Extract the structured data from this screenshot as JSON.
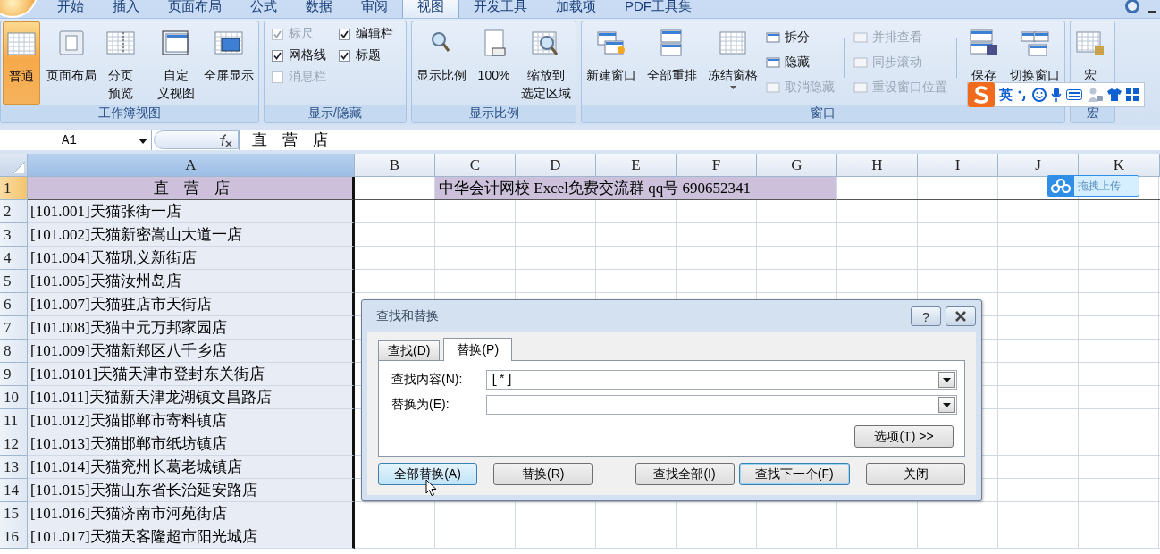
{
  "ribbon_tabs": [
    {
      "label": "开始",
      "selected": false
    },
    {
      "label": "插入",
      "selected": false
    },
    {
      "label": "页面布局",
      "selected": false
    },
    {
      "label": "公式",
      "selected": false
    },
    {
      "label": "数据",
      "selected": false
    },
    {
      "label": "审阅",
      "selected": false
    },
    {
      "label": "视图",
      "selected": true
    },
    {
      "label": "开发工具",
      "selected": false
    },
    {
      "label": "加载项",
      "selected": false
    },
    {
      "label": "PDF工具集",
      "selected": false
    }
  ],
  "ribbon_groups": [
    {
      "label": "工作簿视图",
      "items": [
        {
          "kind": "large",
          "label": "普通",
          "selected": true,
          "disabled": false,
          "wrap": false
        },
        {
          "kind": "large",
          "label": "页面布局",
          "selected": false,
          "disabled": false,
          "wrap": false
        },
        {
          "kind": "large",
          "label": "分页预览",
          "selected": false,
          "disabled": false,
          "wrap": true
        },
        {
          "kind": "separator"
        },
        {
          "kind": "large",
          "label": "自定义视图",
          "selected": false,
          "disabled": false,
          "wrap": true
        },
        {
          "kind": "large",
          "label": "全屏显示",
          "selected": false,
          "disabled": false,
          "wrap": false
        }
      ]
    },
    {
      "label": "显示/隐藏",
      "items": [
        {
          "kind": "check",
          "label": "标尺",
          "checked": true,
          "disabled": true
        },
        {
          "kind": "check",
          "label": "编辑栏",
          "checked": true,
          "disabled": false
        },
        {
          "kind": "check",
          "label": "网格线",
          "checked": true,
          "disabled": false
        },
        {
          "kind": "check",
          "label": "标题",
          "checked": true,
          "disabled": false
        },
        {
          "kind": "check",
          "label": "消息栏",
          "checked": false,
          "disabled": true
        }
      ]
    },
    {
      "label": "显示比例",
      "items": [
        {
          "kind": "large",
          "label": "显示比例",
          "selected": false,
          "disabled": false,
          "wrap": false
        },
        {
          "kind": "large",
          "label": "100%",
          "selected": false,
          "disabled": false,
          "wrap": false
        },
        {
          "kind": "large",
          "label": "缩放到选定区域",
          "selected": false,
          "disabled": false,
          "wrap": true
        }
      ]
    },
    {
      "label": "窗口",
      "items": [
        {
          "kind": "large",
          "label": "新建窗口",
          "selected": false,
          "disabled": false,
          "wrap": false
        },
        {
          "kind": "large",
          "label": "全部重排",
          "selected": false,
          "disabled": false,
          "wrap": false
        },
        {
          "kind": "large",
          "label": "冻结窗格",
          "selected": false,
          "disabled": false,
          "wrap": false,
          "dropdown": true
        },
        {
          "kind": "stack",
          "items": [
            {
              "label": "拆分",
              "disabled": false
            },
            {
              "label": "隐藏",
              "disabled": false
            },
            {
              "label": "取消隐藏",
              "disabled": true
            }
          ]
        },
        {
          "kind": "separator"
        },
        {
          "kind": "stack",
          "items": [
            {
              "label": "并排查看",
              "disabled": true
            },
            {
              "label": "同步滚动",
              "disabled": true
            },
            {
              "label": "重设窗口位置",
              "disabled": true
            }
          ]
        },
        {
          "kind": "separator"
        },
        {
          "kind": "large",
          "label": "保存",
          "selected": false,
          "disabled": false,
          "wrap": false
        },
        {
          "kind": "large",
          "label": "切换窗口",
          "selected": false,
          "disabled": false,
          "wrap": false
        }
      ]
    },
    {
      "label": "宏",
      "items": [
        {
          "kind": "large",
          "label": "宏",
          "selected": false,
          "disabled": false,
          "wrap": false
        }
      ]
    }
  ],
  "formula_bar": {
    "name_box": "A1",
    "formula": "直　营　店"
  },
  "columns": [
    {
      "label": "A",
      "selected": true
    },
    {
      "label": "B",
      "selected": false
    },
    {
      "label": "C",
      "selected": false
    },
    {
      "label": "D",
      "selected": false
    },
    {
      "label": "E",
      "selected": false
    },
    {
      "label": "F",
      "selected": false
    },
    {
      "label": "G",
      "selected": false
    },
    {
      "label": "H",
      "selected": false
    },
    {
      "label": "I",
      "selected": false
    },
    {
      "label": "J",
      "selected": false
    },
    {
      "label": "K",
      "selected": false
    }
  ],
  "rows": [
    {
      "number": "1",
      "active": true,
      "a": "直　营　店",
      "c_to_g": "中华会计网校 Excel免费交流群 qq号 690652341"
    },
    {
      "number": "2",
      "active": false,
      "a": "[101.001]天猫张街一店"
    },
    {
      "number": "3",
      "active": false,
      "a": "[101.002]天猫新密嵩山大道一店"
    },
    {
      "number": "4",
      "active": false,
      "a": "[101.004]天猫巩义新街店"
    },
    {
      "number": "5",
      "active": false,
      "a": "[101.005]天猫汝州岛店"
    },
    {
      "number": "6",
      "active": false,
      "a": "[101.007]天猫驻店市天街店"
    },
    {
      "number": "7",
      "active": false,
      "a": "[101.008]天猫中元万邦家园店"
    },
    {
      "number": "8",
      "active": false,
      "a": "[101.009]天猫新郑区八千乡店"
    },
    {
      "number": "9",
      "active": false,
      "a": "[101.0101]天猫天津市登封东关街店"
    },
    {
      "number": "10",
      "active": false,
      "a": "[101.011]天猫新天津龙湖镇文昌路店"
    },
    {
      "number": "11",
      "active": false,
      "a": "[101.012]天猫邯郸市寄料镇店"
    },
    {
      "number": "12",
      "active": false,
      "a": "[101.013]天猫邯郸市纸坊镇店"
    },
    {
      "number": "13",
      "active": false,
      "a": "[101.014]天猫兖州长葛老城镇店"
    },
    {
      "number": "14",
      "active": false,
      "a": "[101.015]天猫山东省长治延安路店"
    },
    {
      "number": "15",
      "active": false,
      "a": "[101.016]天猫济南市河苑街店"
    },
    {
      "number": "16",
      "active": false,
      "a": "[101.017]天猫天客隆超市阳光城店"
    }
  ],
  "dialog": {
    "title": "查找和替换",
    "help": "?",
    "tabs": [
      {
        "label": "查找(D)",
        "selected": false
      },
      {
        "label": "替换(P)",
        "selected": true
      }
    ],
    "fields": [
      {
        "label": "查找内容(N):",
        "value": "[*]"
      },
      {
        "label": "替换为(E):"
      }
    ],
    "options_button": "选项(T) >>",
    "buttons": [
      {
        "label": "全部替换(A)",
        "hover": true,
        "default": false
      },
      {
        "label": "替换(R)",
        "hover": false,
        "default": false
      },
      {
        "label": "查找全部(I)",
        "hover": false,
        "default": false
      },
      {
        "label": "查找下一个(F)",
        "hover": false,
        "default": true
      },
      {
        "label": "关闭",
        "hover": false,
        "default": false
      }
    ]
  },
  "ime_bar": {
    "mode": "英"
  },
  "upload_widget": {
    "label": "拖拽上传"
  }
}
